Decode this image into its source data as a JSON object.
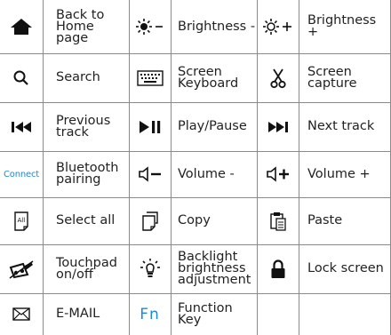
{
  "rows": [
    [
      {
        "icon": "home-icon",
        "label": "Back to\nHome page"
      },
      {
        "icon": "brightness-down-icon",
        "label": "Brightness -"
      },
      {
        "icon": "brightness-up-icon",
        "label": "Brightness +"
      }
    ],
    [
      {
        "icon": "search-icon",
        "label": "Search"
      },
      {
        "icon": "keyboard-icon",
        "label": "Screen\nKeyboard"
      },
      {
        "icon": "scissors-icon",
        "label": "Screen\ncapture"
      }
    ],
    [
      {
        "icon": "previous-track-icon",
        "label": "Previous\ntrack"
      },
      {
        "icon": "play-pause-icon",
        "label": "Play/Pause"
      },
      {
        "icon": "next-track-icon",
        "label": "Next track"
      }
    ],
    [
      {
        "icon": "connect-icon",
        "icon_text": "Connect",
        "label": "Bluetooth\npairing"
      },
      {
        "icon": "volume-down-icon",
        "label": "Volume -"
      },
      {
        "icon": "volume-up-icon",
        "label": "Volume +"
      }
    ],
    [
      {
        "icon": "select-all-icon",
        "icon_text": "All",
        "label": "Select all"
      },
      {
        "icon": "copy-icon",
        "label": "Copy"
      },
      {
        "icon": "paste-icon",
        "label": "Paste"
      }
    ],
    [
      {
        "icon": "touchpad-off-icon",
        "label": "Touchpad\non/off"
      },
      {
        "icon": "backlight-icon",
        "label": "Backlight\nbrightness\nadjustment"
      },
      {
        "icon": "lock-icon",
        "label": "Lock screen"
      }
    ],
    [
      {
        "icon": "mail-icon",
        "label": "E-MAIL"
      },
      {
        "icon": "fn-icon",
        "icon_text": "Fn",
        "label": "Function\nKey"
      },
      {
        "icon": "",
        "label": ""
      }
    ]
  ],
  "colors": {
    "accent": "#1c8ad6",
    "grid": "#8a8a8a",
    "text": "#222222"
  }
}
